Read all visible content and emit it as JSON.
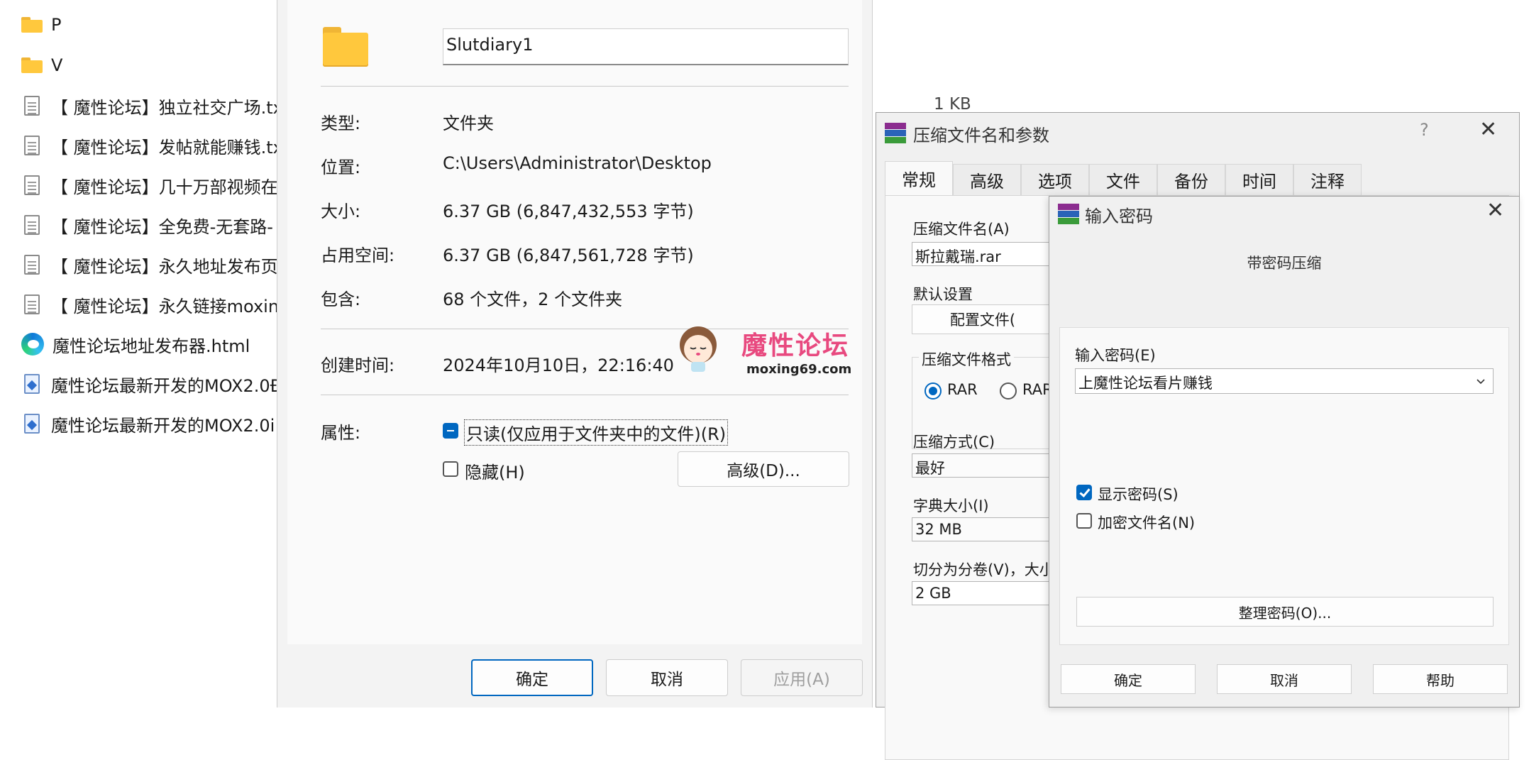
{
  "explorer": {
    "items": [
      {
        "name": "P",
        "icon": "folder-icon"
      },
      {
        "name": "V",
        "icon": "folder-icon"
      },
      {
        "name": "【 魔性论坛】独立社交广场.tx",
        "icon": "text-file-icon"
      },
      {
        "name": "【 魔性论坛】发帖就能赚钱.tx",
        "icon": "text-file-icon"
      },
      {
        "name": "【 魔性论坛】几十万部视频在",
        "icon": "text-file-icon"
      },
      {
        "name": "【 魔性论坛】全免费-无套路-",
        "icon": "text-file-icon"
      },
      {
        "name": "【 魔性论坛】永久地址发布页",
        "icon": "text-file-icon"
      },
      {
        "name": "【 魔性论坛】永久链接moxin",
        "icon": "text-file-icon"
      },
      {
        "name": "魔性论坛地址发布器.html",
        "icon": "edge-icon"
      },
      {
        "name": "魔性论坛最新开发的MOX2.0Ð",
        "icon": "image-file-icon"
      },
      {
        "name": "魔性论坛最新开发的MOX2.0i",
        "icon": "image-file-icon"
      }
    ],
    "size_col": "1 KB"
  },
  "properties": {
    "folder_name": "Slutdiary1",
    "type_label": "类型:",
    "type_value": "文件夹",
    "location_label": "位置:",
    "location_value": "C:\\Users\\Administrator\\Desktop",
    "size_label": "大小:",
    "size_value": "6.37 GB (6,847,432,553 字节)",
    "disk_label": "占用空间:",
    "disk_value": "6.37 GB (6,847,561,728 字节)",
    "contains_label": "包含:",
    "contains_value": "68 个文件，2 个文件夹",
    "created_label": "创建时间:",
    "created_value": "2024年10月10日，22:16:40",
    "attr_label": "属性:",
    "readonly_label": "只读(仅应用于文件夹中的文件)(R)",
    "hidden_label": "隐藏(H)",
    "advanced_button": "高级(D)...",
    "ok_button": "确定",
    "cancel_button": "取消",
    "apply_button": "应用(A)"
  },
  "watermark": {
    "text": "魔性论坛",
    "url": "moxing69.com"
  },
  "rar_dialog": {
    "title": "压缩文件名和参数",
    "help_glyph": "?",
    "tabs": [
      "常规",
      "高级",
      "选项",
      "文件",
      "备份",
      "时间",
      "注释"
    ],
    "archive_name_label": "压缩文件名(A)",
    "archive_name_value": "斯拉戴瑞.rar",
    "default_settings_label": "默认设置",
    "profiles_button": "配置文件(",
    "format_label": "压缩文件格式",
    "format_options": [
      "RAR",
      "RAR"
    ],
    "method_label": "压缩方式(C)",
    "method_value": "最好",
    "dict_label": "字典大小(I)",
    "dict_value": "32 MB",
    "split_label": "切分为分卷(V)，大小",
    "split_value": "2 GB"
  },
  "password_dialog": {
    "title": "输入密码",
    "subtitle": "带密码压缩",
    "password_label": "输入密码(E)",
    "password_value": "上魔性论坛看片赚钱",
    "show_password_label": "显示密码(S)",
    "encrypt_names_label": "加密文件名(N)",
    "organize_button": "整理密码(O)...",
    "ok_button": "确定",
    "cancel_button": "取消",
    "help_button": "帮助"
  },
  "colors": {
    "accent": "#0067c0",
    "watermark": "#e8497f"
  }
}
